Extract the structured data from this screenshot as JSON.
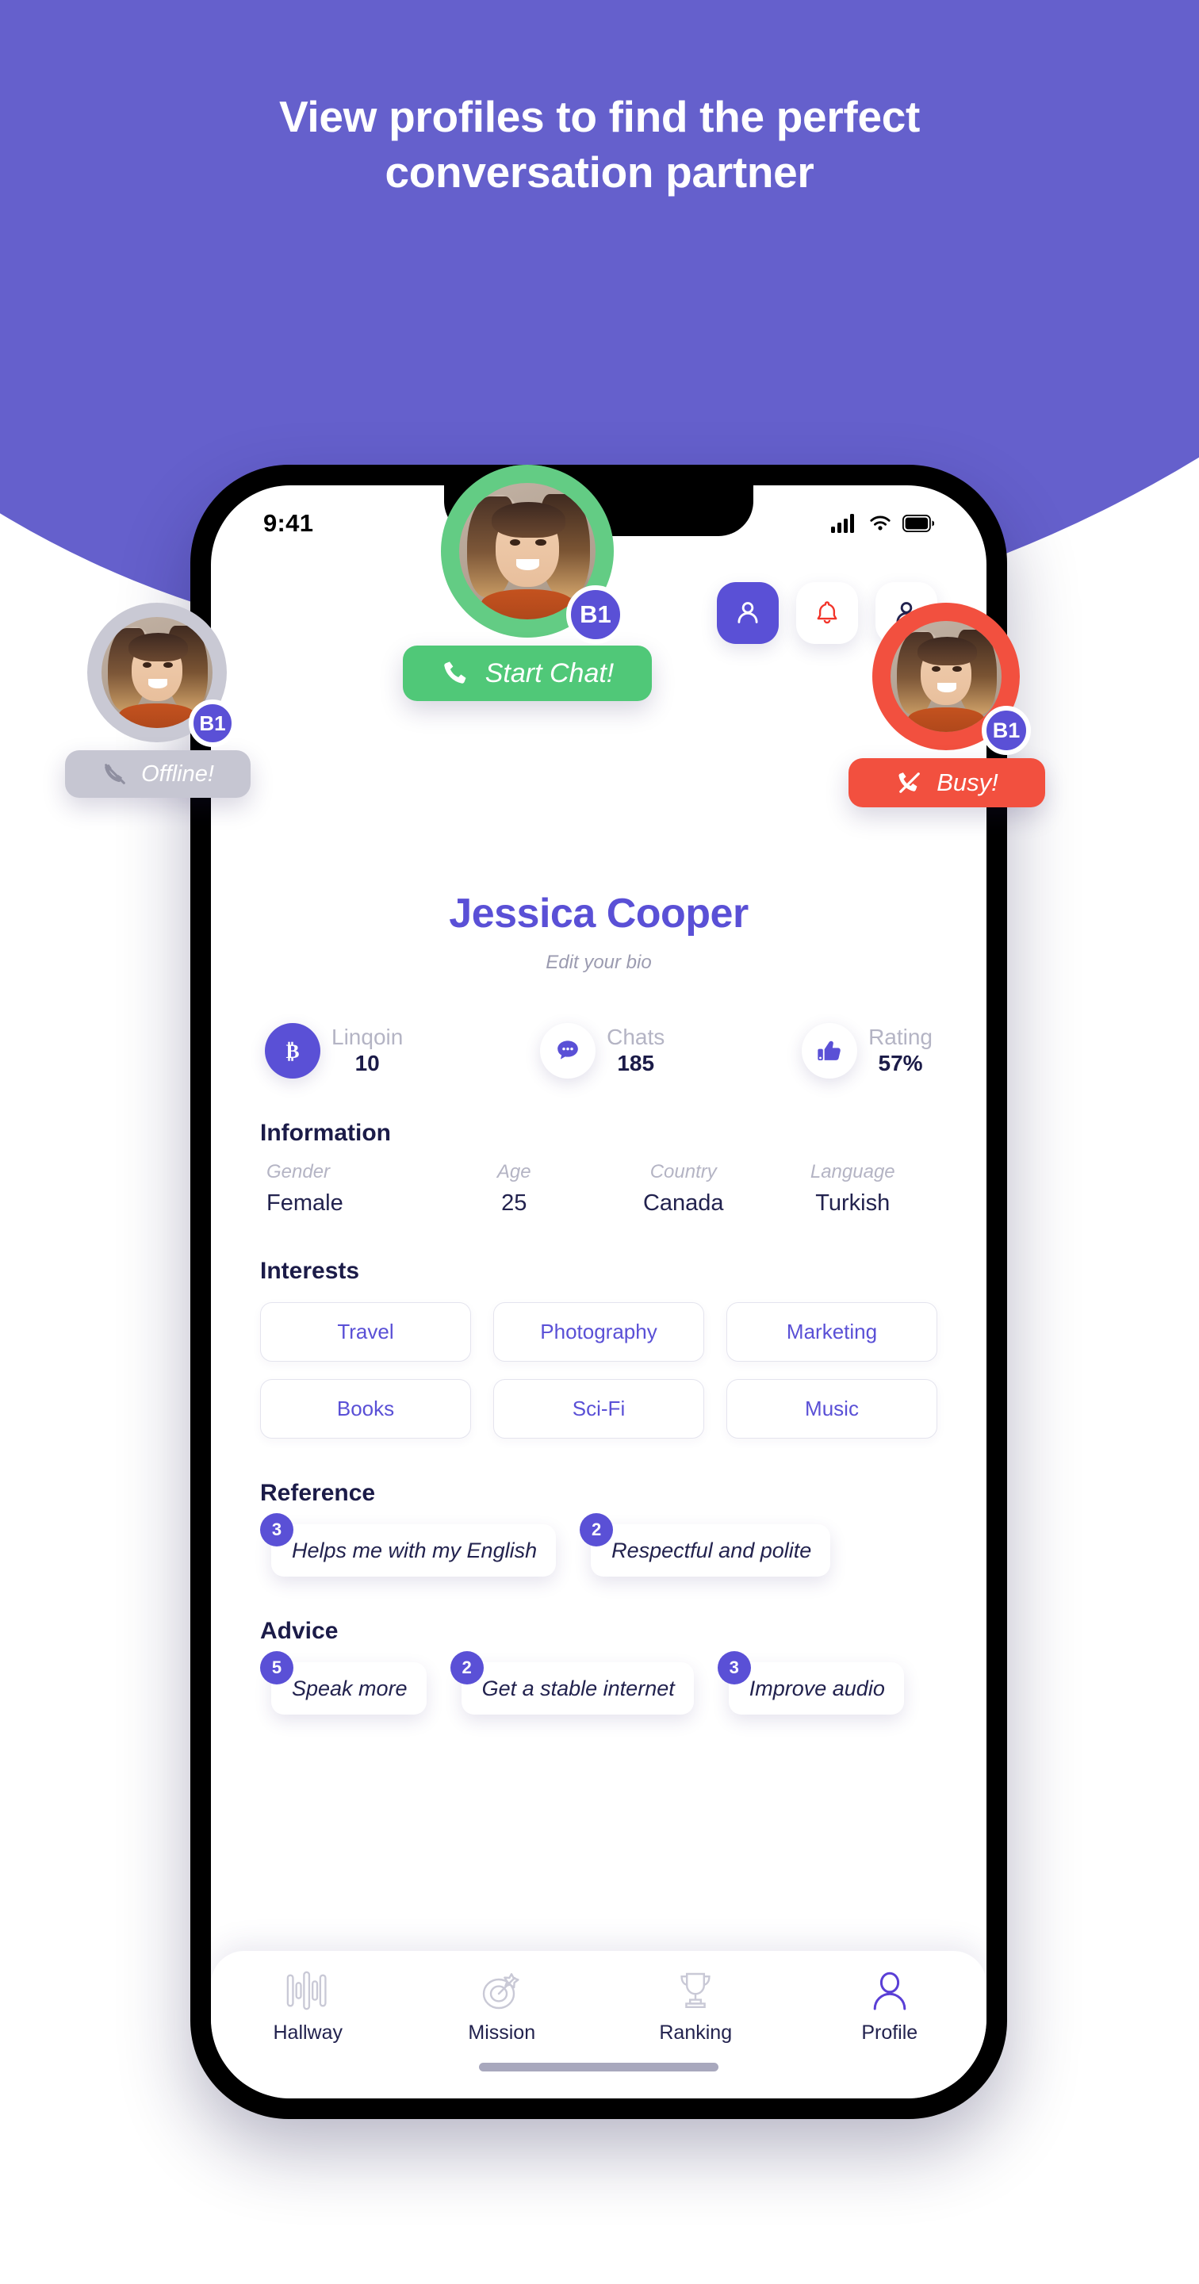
{
  "hero": {
    "headline_line1": "View profiles to find the perfect",
    "headline_line2": "conversation partner",
    "bg_color": "#6560cc"
  },
  "statusbar": {
    "time": "9:41",
    "cellular_icon": "signal-bars-icon",
    "wifi_icon": "wifi-icon",
    "battery_icon": "battery-icon"
  },
  "header_actions": [
    {
      "name": "profile-settings-button",
      "icon": "person-icon",
      "color": "#5a50d6"
    },
    {
      "name": "notifications-button",
      "icon": "bell-icon",
      "color": "#f2503f"
    },
    {
      "name": "account-button",
      "icon": "person-icon",
      "color": "#22224e"
    }
  ],
  "profile": {
    "name": "Jessica Cooper",
    "bio_placeholder": "Edit your bio"
  },
  "stats": [
    {
      "label": "Linqoin",
      "value": "10",
      "icon": "bitcoin-icon",
      "filled": true
    },
    {
      "label": "Chats",
      "value": "185",
      "icon": "chat-bubble-icon",
      "filled": false
    },
    {
      "label": "Rating",
      "value": "57%",
      "icon": "thumbs-up-icon",
      "filled": false
    }
  ],
  "information": {
    "title": "Information",
    "fields": [
      {
        "key": "Gender",
        "value": "Female"
      },
      {
        "key": "Age",
        "value": "25"
      },
      {
        "key": "Country",
        "value": "Canada"
      },
      {
        "key": "Language",
        "value": "Turkish"
      }
    ]
  },
  "interests": {
    "title": "Interests",
    "items": [
      "Travel",
      "Photography",
      "Marketing",
      "Books",
      "Sci-Fi",
      "Music"
    ]
  },
  "reference": {
    "title": "Reference",
    "items": [
      {
        "count": "3",
        "text": "Helps me with my English"
      },
      {
        "count": "2",
        "text": "Respectful and polite"
      }
    ]
  },
  "advice": {
    "title": "Advice",
    "items": [
      {
        "count": "5",
        "text": "Speak more"
      },
      {
        "count": "2",
        "text": "Get a stable internet"
      },
      {
        "count": "3",
        "text": "Improve audio"
      }
    ]
  },
  "tabbar": [
    {
      "label": "Hallway",
      "icon": "waveform-icon",
      "active": false
    },
    {
      "label": "Mission",
      "icon": "target-dart-icon",
      "active": false
    },
    {
      "label": "Ranking",
      "icon": "trophy-icon",
      "active": false
    },
    {
      "label": "Profile",
      "icon": "person-icon",
      "active": true
    }
  ],
  "status_cards": {
    "center": {
      "level": "B1",
      "label": "Start Chat!",
      "icon": "phone-icon",
      "color": "#50c878"
    },
    "left": {
      "level": "B1",
      "label": "Offline!",
      "icon": "phone-off-icon",
      "color": "#c6c6d2"
    },
    "right": {
      "level": "B1",
      "label": "Busy!",
      "icon": "phone-busy-icon",
      "color": "#f2503f"
    }
  }
}
